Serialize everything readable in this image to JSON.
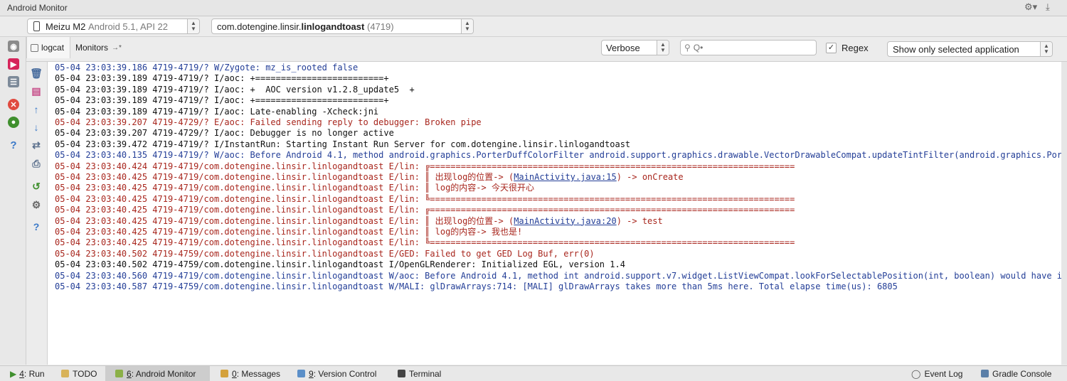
{
  "window": {
    "title": "Android Monitor"
  },
  "device_bar": {
    "device_name": "Meizu M2",
    "device_detail": "Android 5.1, API 22",
    "process_prefix": "com.dotengine.linsir.",
    "process_bold": "linlogandtoast",
    "process_pid": "(4719)"
  },
  "tabs": [
    {
      "label": "logcat"
    },
    {
      "label": "Monitors"
    }
  ],
  "filter_bar": {
    "level": "Verbose",
    "search_value": "",
    "search_placeholder": "Q•",
    "regex_label": "Regex",
    "regex_checked": true,
    "scope": "Show only selected application"
  },
  "log_lines": [
    {
      "level": "W",
      "text": "05-04 23:03:39.186 4719-4719/? W/Zygote: mz_is_rooted false"
    },
    {
      "level": "I",
      "text": "05-04 23:03:39.189 4719-4719/? I/aoc: +=========================+"
    },
    {
      "level": "I",
      "text": "05-04 23:03:39.189 4719-4719/? I/aoc: +  AOC version v1.2.8_update5  +"
    },
    {
      "level": "I",
      "text": "05-04 23:03:39.189 4719-4719/? I/aoc: +=========================+"
    },
    {
      "level": "I",
      "text": "05-04 23:03:39.189 4719-4719/? I/aoc: Late-enabling -Xcheck:jni"
    },
    {
      "level": "E",
      "text": "05-04 23:03:39.207 4719-4729/? E/aoc: Failed sending reply to debugger: Broken pipe"
    },
    {
      "level": "I",
      "text": "05-04 23:03:39.207 4719-4729/? I/aoc: Debugger is no longer active"
    },
    {
      "level": "I",
      "text": "05-04 23:03:39.472 4719-4719/? I/InstantRun: Starting Instant Run Server for com.dotengine.linsir.linlogandtoast"
    },
    {
      "level": "W",
      "text": "05-04 23:03:40.135 4719-4719/? W/aoc: Before Android 4.1, method android.graphics.PorterDuffColorFilter android.support.graphics.drawable.VectorDrawableCompat.updateTintFilter(android.graphics.Porte"
    },
    {
      "level": "E",
      "text": "05-04 23:03:40.424 4719-4719/com.dotengine.linsir.linlogandtoast E/lin: ╔======================================================================="
    },
    {
      "level": "E",
      "text": "05-04 23:03:40.425 4719-4719/com.dotengine.linsir.linlogandtoast E/lin: ║ 出现log的位置-> (",
      "link": "MainActivity.java:15",
      "suffix": ") -> onCreate"
    },
    {
      "level": "E",
      "text": "05-04 23:03:40.425 4719-4719/com.dotengine.linsir.linlogandtoast E/lin: ║ log的内容-> 今天很开心"
    },
    {
      "level": "E",
      "text": "05-04 23:03:40.425 4719-4719/com.dotengine.linsir.linlogandtoast E/lin: ╚======================================================================="
    },
    {
      "level": "E",
      "text": "05-04 23:03:40.425 4719-4719/com.dotengine.linsir.linlogandtoast E/lin: ╔======================================================================="
    },
    {
      "level": "E",
      "text": "05-04 23:03:40.425 4719-4719/com.dotengine.linsir.linlogandtoast E/lin: ║ 出现log的位置-> (",
      "link": "MainActivity.java:20",
      "suffix": ") -> test"
    },
    {
      "level": "E",
      "text": "05-04 23:03:40.425 4719-4719/com.dotengine.linsir.linlogandtoast E/lin: ║ log的内容-> 我也是!"
    },
    {
      "level": "E",
      "text": "05-04 23:03:40.425 4719-4719/com.dotengine.linsir.linlogandtoast E/lin: ╚======================================================================="
    },
    {
      "level": "E",
      "text": "05-04 23:03:40.502 4719-4759/com.dotengine.linsir.linlogandtoast E/GED: Failed to get GED Log Buf, err(0)"
    },
    {
      "level": "I",
      "text": "05-04 23:03:40.502 4719-4759/com.dotengine.linsir.linlogandtoast I/OpenGLRenderer: Initialized EGL, version 1.4"
    },
    {
      "level": "W",
      "text": "05-04 23:03:40.560 4719-4719/com.dotengine.linsir.linlogandtoast W/aoc: Before Android 4.1, method int android.support.v7.widget.ListViewCompat.lookForSelectablePosition(int, boolean) would have inc"
    },
    {
      "level": "W",
      "text": "05-04 23:03:40.587 4719-4759/com.dotengine.linsir.linlogandtoast W/MALI: glDrawArrays:714: [MALI] glDrawArrays takes more than 5ms here. Total elapse time(us): 6805"
    }
  ],
  "status_bar": {
    "run": {
      "num": "4",
      "label": ": Run"
    },
    "todo": "TODO",
    "monitor": {
      "num": "6",
      "label": ": Android Monitor"
    },
    "messages": {
      "num": "0",
      "label": ": Messages"
    },
    "vcs": {
      "num": "9",
      "label": ": Version Control"
    },
    "terminal": "Terminal",
    "event_log": "Event Log",
    "gradle": "Gradle Console"
  },
  "colors": {
    "warn": "#233e97",
    "error": "#a8261d",
    "info": "#111111"
  }
}
